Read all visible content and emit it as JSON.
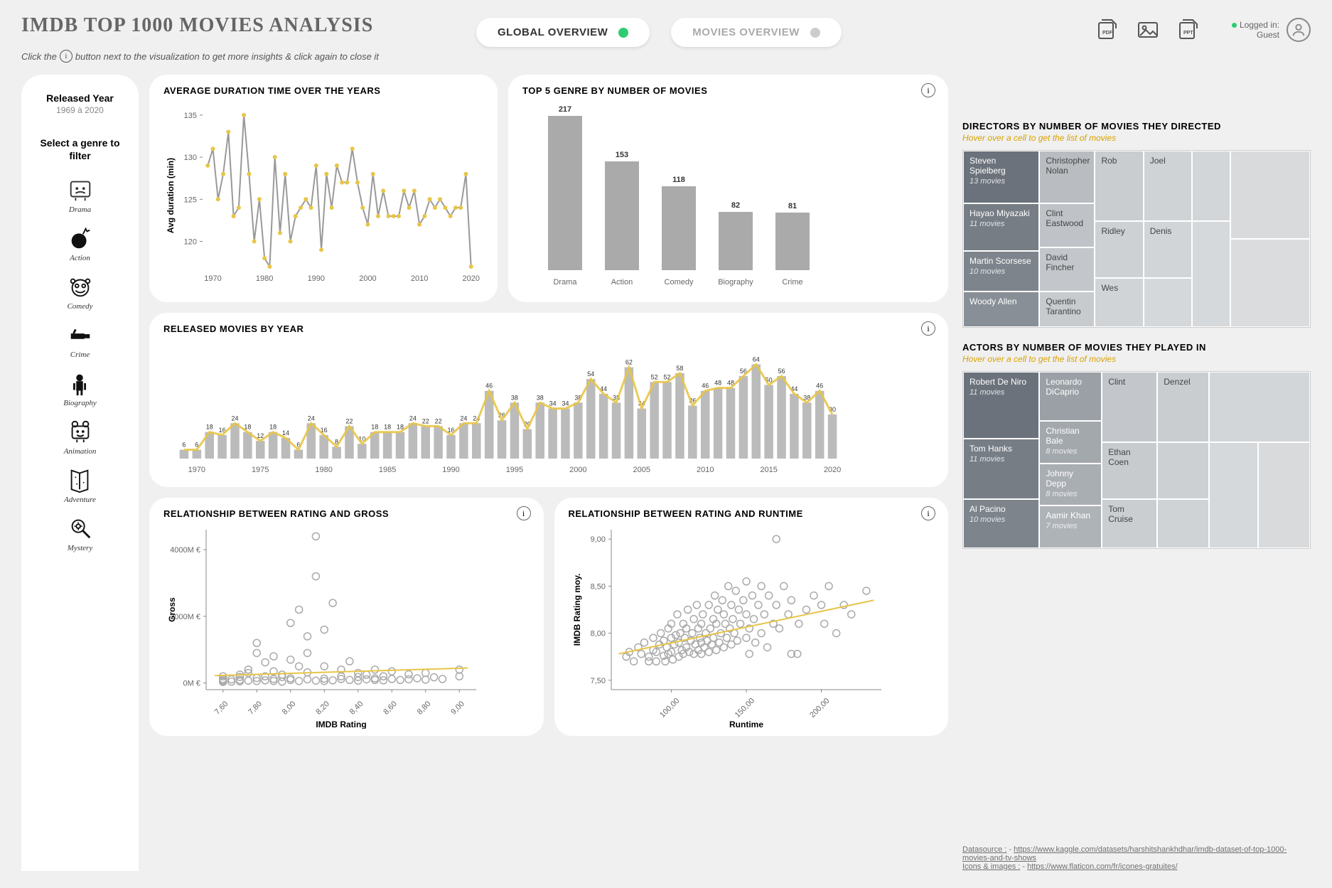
{
  "header": {
    "title": "IMDB TOP 1000 MOVIES ANALYSIS",
    "hint_before": "Click the",
    "hint_after": "button next to the visualization to get more insights & click again to close it",
    "tab_global": "GLOBAL OVERVIEW",
    "tab_movies": "MOVIES OVERVIEW",
    "logged_label": "Logged in:",
    "logged_user": "Guest"
  },
  "sidebar": {
    "released_label": "Released Year",
    "released_range": "1969 à 2020",
    "filter_label": "Select a genre to filter",
    "genres": [
      "Drama",
      "Action",
      "Comedy",
      "Crime",
      "Biography",
      "Animation",
      "Adventure",
      "Mystery"
    ]
  },
  "charts": {
    "duration": {
      "title": "AVERAGE DURATION TIME OVER THE YEARS",
      "ylabel": "Avg duration (min)"
    },
    "genre_bar": {
      "title": "TOP 5 GENRE BY NUMBER OF MOVIES"
    },
    "released": {
      "title": "RELEASED MOVIES BY YEAR"
    },
    "rating_gross": {
      "title": "RELATIONSHIP BETWEEN RATING AND GROSS",
      "xlabel": "IMDB Rating",
      "ylabel": "Gross"
    },
    "rating_runtime": {
      "title": "RELATIONSHIP BETWEEN RATING AND RUNTIME",
      "xlabel": "Runtime",
      "ylabel": "IMDB Rating moy."
    }
  },
  "treemaps": {
    "directors": {
      "title": "DIRECTORS BY NUMBER OF MOVIES THEY DIRECTED",
      "hint": "Hover over a cell to get the list of movies"
    },
    "actors": {
      "title": "ACTORS BY NUMBER OF MOVIES THEY PLAYED IN",
      "hint": "Hover over a cell to get the list of movies"
    }
  },
  "sources": {
    "ds_label": "Datasource :",
    "ds_url": "https://www.kaggle.com/datasets/harshitshankhdhar/imdb-dataset-of-top-1000-movies-and-tv-shows",
    "ic_label": "Icons & images :",
    "ic_url": "https://www.flaticon.com/fr/icones-gratuites/"
  },
  "chart_data": {
    "duration_line": {
      "type": "line",
      "xlabel": "",
      "ylabel": "Avg duration (min)",
      "ylim": [
        117,
        136
      ],
      "xticks": [
        1970,
        1980,
        1990,
        2000,
        2010,
        2020
      ],
      "x": [
        1969,
        1970,
        1971,
        1972,
        1973,
        1974,
        1975,
        1976,
        1977,
        1978,
        1979,
        1980,
        1981,
        1982,
        1983,
        1984,
        1985,
        1986,
        1987,
        1988,
        1989,
        1990,
        1991,
        1992,
        1993,
        1994,
        1995,
        1996,
        1997,
        1998,
        1999,
        2000,
        2001,
        2002,
        2003,
        2004,
        2005,
        2006,
        2007,
        2008,
        2009,
        2010,
        2011,
        2012,
        2013,
        2014,
        2015,
        2016,
        2017,
        2018,
        2019,
        2020
      ],
      "y": [
        129,
        131,
        125,
        128,
        133,
        123,
        124,
        135,
        128,
        120,
        125,
        118,
        117,
        130,
        121,
        128,
        120,
        123,
        124,
        125,
        124,
        129,
        119,
        128,
        124,
        129,
        127,
        127,
        131,
        127,
        124,
        122,
        128,
        123,
        126,
        123,
        123,
        123,
        126,
        124,
        126,
        122,
        123,
        125,
        124,
        125,
        124,
        123,
        124,
        124,
        128,
        117
      ]
    },
    "genre_bar": {
      "type": "bar",
      "categories": [
        "Drama",
        "Action",
        "Comedy",
        "Biography",
        "Crime"
      ],
      "values": [
        217,
        153,
        118,
        82,
        81
      ],
      "ylim": [
        0,
        230
      ]
    },
    "released_by_year": {
      "type": "bar",
      "xticks": [
        1970,
        1975,
        1980,
        1985,
        1990,
        1995,
        2000,
        2005,
        2010,
        2015,
        2020
      ],
      "x": [
        1969,
        1970,
        1971,
        1972,
        1973,
        1974,
        1975,
        1976,
        1977,
        1978,
        1979,
        1980,
        1981,
        1982,
        1983,
        1984,
        1985,
        1986,
        1987,
        1988,
        1989,
        1990,
        1991,
        1992,
        1993,
        1994,
        1995,
        1996,
        1997,
        1998,
        1999,
        2000,
        2001,
        2002,
        2003,
        2004,
        2005,
        2006,
        2007,
        2008,
        2009,
        2010,
        2011,
        2012,
        2013,
        2014,
        2015,
        2016,
        2017,
        2018,
        2019,
        2020
      ],
      "values": [
        6,
        6,
        18,
        16,
        24,
        18,
        12,
        18,
        14,
        6,
        24,
        16,
        8,
        22,
        10,
        18,
        18,
        18,
        24,
        22,
        22,
        16,
        24,
        24,
        46,
        26,
        38,
        20,
        38,
        34,
        34,
        38,
        54,
        44,
        38,
        62,
        34,
        52,
        52,
        58,
        36,
        46,
        48,
        48,
        56,
        64,
        50,
        56,
        44,
        38,
        46,
        30
      ],
      "ylim": [
        0,
        70
      ]
    },
    "rating_gross": {
      "type": "scatter",
      "xlabel": "IMDB Rating",
      "ylabel": "Gross",
      "xlim": [
        7.5,
        9.1
      ],
      "ylim": [
        -200,
        4600
      ],
      "xticks": [
        7.6,
        7.8,
        8.0,
        8.2,
        8.4,
        8.6,
        8.8,
        9.0
      ],
      "yticks": [
        0,
        2000,
        4000
      ],
      "yunit": "M €",
      "points": [
        [
          7.6,
          60
        ],
        [
          7.6,
          120
        ],
        [
          7.6,
          30
        ],
        [
          7.6,
          200
        ],
        [
          7.6,
          80
        ],
        [
          7.65,
          40
        ],
        [
          7.65,
          110
        ],
        [
          7.7,
          90
        ],
        [
          7.7,
          250
        ],
        [
          7.7,
          50
        ],
        [
          7.7,
          180
        ],
        [
          7.75,
          70
        ],
        [
          7.75,
          300
        ],
        [
          7.75,
          400
        ],
        [
          7.8,
          60
        ],
        [
          7.8,
          150
        ],
        [
          7.8,
          900
        ],
        [
          7.8,
          1200
        ],
        [
          7.85,
          620
        ],
        [
          7.85,
          80
        ],
        [
          7.85,
          200
        ],
        [
          7.9,
          120
        ],
        [
          7.9,
          350
        ],
        [
          7.9,
          60
        ],
        [
          7.9,
          800
        ],
        [
          7.95,
          40
        ],
        [
          7.95,
          250
        ],
        [
          7.95,
          180
        ],
        [
          8.0,
          90
        ],
        [
          8.0,
          700
        ],
        [
          8.0,
          1800
        ],
        [
          8.0,
          140
        ],
        [
          8.05,
          60
        ],
        [
          8.05,
          500
        ],
        [
          8.05,
          2200
        ],
        [
          8.1,
          110
        ],
        [
          8.1,
          900
        ],
        [
          8.1,
          320
        ],
        [
          8.1,
          1400
        ],
        [
          8.15,
          70
        ],
        [
          8.15,
          3200
        ],
        [
          8.15,
          4400
        ],
        [
          8.2,
          130
        ],
        [
          8.2,
          60
        ],
        [
          8.2,
          1600
        ],
        [
          8.2,
          500
        ],
        [
          8.25,
          80
        ],
        [
          8.25,
          2400
        ],
        [
          8.3,
          120
        ],
        [
          8.3,
          400
        ],
        [
          8.3,
          200
        ],
        [
          8.35,
          90
        ],
        [
          8.35,
          650
        ],
        [
          8.4,
          70
        ],
        [
          8.4,
          300
        ],
        [
          8.4,
          180
        ],
        [
          8.45,
          110
        ],
        [
          8.45,
          250
        ],
        [
          8.5,
          90
        ],
        [
          8.5,
          400
        ],
        [
          8.5,
          140
        ],
        [
          8.55,
          80
        ],
        [
          8.55,
          200
        ],
        [
          8.6,
          120
        ],
        [
          8.6,
          350
        ],
        [
          8.65,
          90
        ],
        [
          8.7,
          110
        ],
        [
          8.7,
          260
        ],
        [
          8.75,
          140
        ],
        [
          8.8,
          100
        ],
        [
          8.8,
          300
        ],
        [
          8.85,
          170
        ],
        [
          8.9,
          120
        ],
        [
          9.0,
          200
        ],
        [
          9.0,
          400
        ]
      ],
      "trend": [
        [
          7.55,
          220
        ],
        [
          9.05,
          450
        ]
      ]
    },
    "rating_runtime": {
      "type": "scatter",
      "xlabel": "Runtime",
      "ylabel": "IMDB Rating moy.",
      "xlim": [
        60,
        240
      ],
      "ylim": [
        7.4,
        9.1
      ],
      "xticks": [
        100,
        150,
        200
      ],
      "yticks": [
        7.5,
        8.0,
        8.5,
        9.0
      ],
      "points": [
        [
          70,
          7.75
        ],
        [
          72,
          7.8
        ],
        [
          75,
          7.7
        ],
        [
          78,
          7.85
        ],
        [
          80,
          7.78
        ],
        [
          82,
          7.9
        ],
        [
          85,
          7.75
        ],
        [
          85,
          7.7
        ],
        [
          88,
          7.82
        ],
        [
          88,
          7.95
        ],
        [
          90,
          7.8
        ],
        [
          90,
          7.7
        ],
        [
          92,
          7.88
        ],
        [
          93,
          8.0
        ],
        [
          95,
          7.76
        ],
        [
          95,
          7.92
        ],
        [
          96,
          7.7
        ],
        [
          97,
          7.85
        ],
        [
          98,
          8.05
        ],
        [
          98,
          7.78
        ],
        [
          100,
          7.8
        ],
        [
          100,
          7.95
        ],
        [
          100,
          8.1
        ],
        [
          101,
          7.72
        ],
        [
          102,
          7.88
        ],
        [
          103,
          7.98
        ],
        [
          104,
          8.2
        ],
        [
          105,
          7.75
        ],
        [
          105,
          7.9
        ],
        [
          106,
          8.0
        ],
        [
          107,
          7.82
        ],
        [
          108,
          8.1
        ],
        [
          108,
          7.78
        ],
        [
          109,
          7.95
        ],
        [
          110,
          7.85
        ],
        [
          110,
          8.05
        ],
        [
          111,
          8.25
        ],
        [
          112,
          7.8
        ],
        [
          113,
          7.92
        ],
        [
          114,
          8.0
        ],
        [
          115,
          7.78
        ],
        [
          115,
          8.15
        ],
        [
          116,
          7.88
        ],
        [
          117,
          8.3
        ],
        [
          118,
          7.82
        ],
        [
          118,
          8.05
        ],
        [
          119,
          7.95
        ],
        [
          120,
          7.78
        ],
        [
          120,
          8.1
        ],
        [
          120,
          7.9
        ],
        [
          121,
          8.2
        ],
        [
          122,
          7.85
        ],
        [
          123,
          8.0
        ],
        [
          124,
          7.92
        ],
        [
          125,
          7.8
        ],
        [
          125,
          8.3
        ],
        [
          126,
          8.05
        ],
        [
          127,
          7.88
        ],
        [
          128,
          8.15
        ],
        [
          128,
          7.95
        ],
        [
          129,
          8.4
        ],
        [
          130,
          7.82
        ],
        [
          130,
          8.1
        ],
        [
          131,
          8.25
        ],
        [
          132,
          7.9
        ],
        [
          133,
          8.0
        ],
        [
          134,
          8.35
        ],
        [
          135,
          7.85
        ],
        [
          135,
          8.2
        ],
        [
          136,
          8.1
        ],
        [
          137,
          7.95
        ],
        [
          138,
          8.5
        ],
        [
          139,
          8.05
        ],
        [
          140,
          7.88
        ],
        [
          140,
          8.3
        ],
        [
          141,
          8.15
        ],
        [
          142,
          8.0
        ],
        [
          143,
          8.45
        ],
        [
          144,
          7.92
        ],
        [
          145,
          8.25
        ],
        [
          146,
          8.1
        ],
        [
          148,
          8.35
        ],
        [
          150,
          7.95
        ],
        [
          150,
          8.2
        ],
        [
          150,
          8.55
        ],
        [
          152,
          7.78
        ],
        [
          152,
          8.05
        ],
        [
          154,
          8.4
        ],
        [
          155,
          8.15
        ],
        [
          156,
          7.9
        ],
        [
          158,
          8.3
        ],
        [
          160,
          8.0
        ],
        [
          160,
          8.5
        ],
        [
          162,
          8.2
        ],
        [
          164,
          7.85
        ],
        [
          165,
          8.4
        ],
        [
          168,
          8.1
        ],
        [
          170,
          8.3
        ],
        [
          170,
          9.0
        ],
        [
          172,
          8.05
        ],
        [
          175,
          8.5
        ],
        [
          178,
          8.2
        ],
        [
          180,
          7.78
        ],
        [
          180,
          8.35
        ],
        [
          184,
          7.78
        ],
        [
          185,
          8.1
        ],
        [
          190,
          8.25
        ],
        [
          195,
          8.4
        ],
        [
          200,
          8.3
        ],
        [
          202,
          8.1
        ],
        [
          205,
          8.5
        ],
        [
          210,
          8.0
        ],
        [
          215,
          8.3
        ],
        [
          220,
          8.2
        ],
        [
          230,
          8.45
        ]
      ],
      "trend": [
        [
          65,
          7.78
        ],
        [
          235,
          8.35
        ]
      ]
    },
    "directors_treemap": {
      "type": "treemap",
      "items": [
        {
          "name": "Steven Spielberg",
          "count": 13
        },
        {
          "name": "Hayao Miyazaki",
          "count": 11
        },
        {
          "name": "Martin Scorsese",
          "count": 10
        },
        {
          "name": "Woody Allen",
          "count": 9
        },
        {
          "name": "Christopher Nolan",
          "count": 9
        },
        {
          "name": "Clint Eastwood",
          "count": 8
        },
        {
          "name": "David Fincher",
          "count": 8
        },
        {
          "name": "Quentin Tarantino",
          "count": 8
        },
        {
          "name": "Rob",
          "count": 7
        },
        {
          "name": "Ridley",
          "count": 7
        },
        {
          "name": "Wes",
          "count": 6
        },
        {
          "name": "Joel",
          "count": 6
        },
        {
          "name": "Denis",
          "count": 6
        }
      ]
    },
    "actors_treemap": {
      "type": "treemap",
      "items": [
        {
          "name": "Robert De Niro",
          "count": 11
        },
        {
          "name": "Tom Hanks",
          "count": 11
        },
        {
          "name": "Al Pacino",
          "count": 10
        },
        {
          "name": "Leonardo DiCaprio",
          "count": 9
        },
        {
          "name": "Christian Bale",
          "count": 8
        },
        {
          "name": "Johnny Depp",
          "count": 8
        },
        {
          "name": "Aamir Khan",
          "count": 7
        },
        {
          "name": "Clint",
          "count": 7
        },
        {
          "name": "Ethan Coen",
          "count": 6
        },
        {
          "name": "Denzel",
          "count": 6
        },
        {
          "name": "Tom Cruise",
          "count": 5
        }
      ]
    }
  }
}
